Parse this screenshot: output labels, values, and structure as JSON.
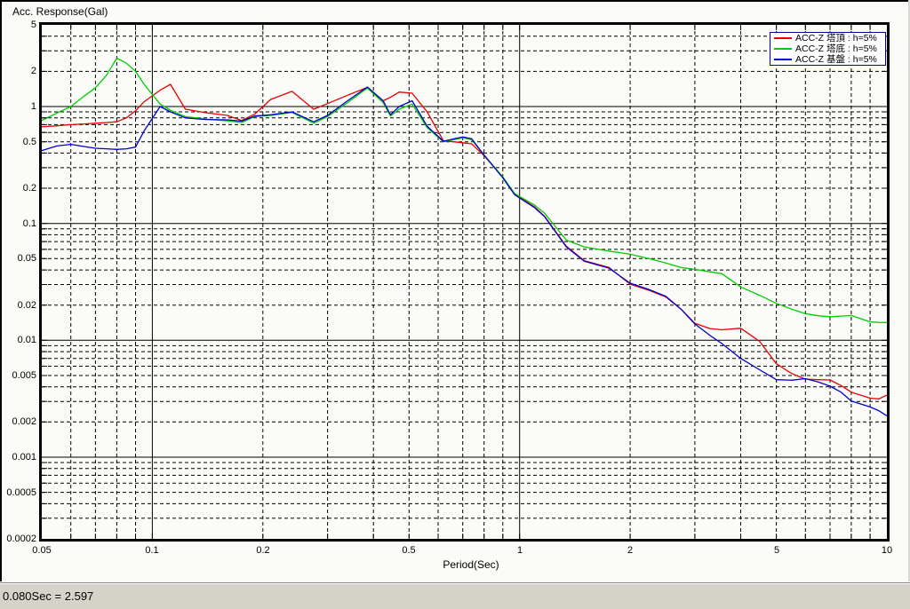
{
  "window": {
    "title": "Acc. Response(Gal)",
    "status_text": "0.080Sec = 2.597"
  },
  "chart_data": {
    "type": "line",
    "title": "Acc. Response(Gal)",
    "xlabel": "Period(Sec)",
    "ylabel": "Acc. Response(Gal)",
    "x_scale": "log",
    "y_scale": "log",
    "xlim": [
      0.05,
      10
    ],
    "ylim": [
      0.0002,
      5
    ],
    "grid": true,
    "legend_position": "top-right",
    "legend_border_color": "#0000aa",
    "x_tick_values": [
      0.05,
      0.1,
      0.2,
      0.5,
      1,
      2,
      5,
      10
    ],
    "x_tick_labels": [
      "0.05",
      "0.1",
      "0.2",
      "0.5",
      "1",
      "2",
      "5",
      "10"
    ],
    "y_tick_values": [
      5,
      2,
      1,
      0.5,
      0.2,
      0.1,
      0.05,
      0.02,
      0.01,
      0.005,
      0.002,
      0.001,
      0.0005,
      0.0002
    ],
    "y_tick_labels": [
      "5",
      "2",
      "1",
      "0.5",
      "0.2",
      "0.1",
      "0.05",
      "0.02",
      "0.01",
      "0.005",
      "0.002",
      "0.001",
      "0.0005",
      "0.0002"
    ],
    "gridlines": {
      "x_solid": [
        0.1,
        1
      ],
      "x_dashed": [
        0.06,
        0.07,
        0.08,
        0.09,
        0.2,
        0.3,
        0.4,
        0.5,
        0.6,
        0.7,
        0.8,
        0.9,
        2,
        3,
        4,
        5,
        6,
        7,
        8,
        9
      ],
      "y_solid": [
        1,
        0.1,
        0.01,
        0.001
      ],
      "y_dashed": [
        4,
        3,
        2,
        0.9,
        0.8,
        0.7,
        0.6,
        0.5,
        0.4,
        0.3,
        0.2,
        0.09,
        0.08,
        0.07,
        0.06,
        0.05,
        0.04,
        0.03,
        0.02,
        0.009,
        0.008,
        0.007,
        0.006,
        0.005,
        0.004,
        0.003,
        0.002,
        0.0009,
        0.0008,
        0.0007,
        0.0006,
        0.0005,
        0.0004,
        0.0003
      ]
    },
    "x": [
      0.05,
      0.055,
      0.06,
      0.065,
      0.07,
      0.075,
      0.08,
      0.085,
      0.09,
      0.095,
      0.105,
      0.112,
      0.123,
      0.14,
      0.16,
      0.175,
      0.19,
      0.21,
      0.24,
      0.275,
      0.3,
      0.34,
      0.385,
      0.425,
      0.445,
      0.47,
      0.51,
      0.56,
      0.62,
      0.7,
      0.74,
      0.8,
      0.9,
      0.97,
      1.0,
      1.1,
      1.17,
      1.34,
      1.5,
      1.75,
      2.0,
      2.25,
      2.5,
      2.75,
      3.0,
      3.3,
      3.55,
      4.0,
      4.5,
      5.0,
      5.5,
      6.0,
      6.5,
      7.0,
      7.5,
      8.0,
      9.0,
      9.5,
      10.0
    ],
    "series": [
      {
        "name": "ACC-Z 塔頂 : h=5%",
        "color": "#e60000",
        "values": [
          0.67,
          0.685,
          0.7,
          0.71,
          0.72,
          0.73,
          0.74,
          0.8,
          0.92,
          1.1,
          1.38,
          1.55,
          0.95,
          0.885,
          0.84,
          0.76,
          0.86,
          1.15,
          1.35,
          0.95,
          1.06,
          1.25,
          1.46,
          1.12,
          1.2,
          1.33,
          1.3,
          0.9,
          0.51,
          0.49,
          0.48,
          0.38,
          0.25,
          0.178,
          0.168,
          0.138,
          0.115,
          0.064,
          0.048,
          0.042,
          0.0302,
          0.0268,
          0.0235,
          0.0185,
          0.014,
          0.0126,
          0.0123,
          0.0127,
          0.0098,
          0.0063,
          0.0052,
          0.00465,
          0.0046,
          0.00458,
          0.0041,
          0.0036,
          0.0032,
          0.00315,
          0.0034
        ]
      },
      {
        "name": "ACC-Z 塔底 : h=5%",
        "color": "#00cc00",
        "values": [
          0.76,
          0.88,
          1.0,
          1.22,
          1.45,
          1.85,
          2.597,
          2.35,
          2.0,
          1.55,
          1.05,
          0.93,
          0.82,
          0.78,
          0.755,
          0.73,
          0.82,
          0.84,
          0.89,
          0.72,
          0.82,
          1.08,
          1.44,
          1.08,
          0.83,
          0.95,
          1.05,
          0.66,
          0.5,
          0.54,
          0.52,
          0.385,
          0.25,
          0.18,
          0.17,
          0.143,
          0.122,
          0.072,
          0.063,
          0.058,
          0.0545,
          0.05,
          0.0458,
          0.042,
          0.0405,
          0.0385,
          0.0372,
          0.0286,
          0.0243,
          0.0207,
          0.0185,
          0.0169,
          0.0162,
          0.0159,
          0.0161,
          0.0163,
          0.0144,
          0.0142,
          0.0142
        ]
      },
      {
        "name": "ACC-Z 基盤 : h=5%",
        "color": "#0000cd",
        "values": [
          0.42,
          0.46,
          0.475,
          0.455,
          0.44,
          0.435,
          0.43,
          0.435,
          0.45,
          0.62,
          1.0,
          0.9,
          0.8,
          0.775,
          0.77,
          0.75,
          0.83,
          0.85,
          0.9,
          0.74,
          0.84,
          1.12,
          1.47,
          1.12,
          0.85,
          1.0,
          1.12,
          0.68,
          0.505,
          0.55,
          0.53,
          0.385,
          0.245,
          0.176,
          0.165,
          0.136,
          0.114,
          0.063,
          0.0475,
          0.0415,
          0.0308,
          0.0272,
          0.0238,
          0.0185,
          0.0138,
          0.011,
          0.0094,
          0.007,
          0.0056,
          0.0046,
          0.00455,
          0.0047,
          0.0044,
          0.00405,
          0.0036,
          0.00302,
          0.00269,
          0.0025,
          0.00226
        ]
      }
    ]
  }
}
